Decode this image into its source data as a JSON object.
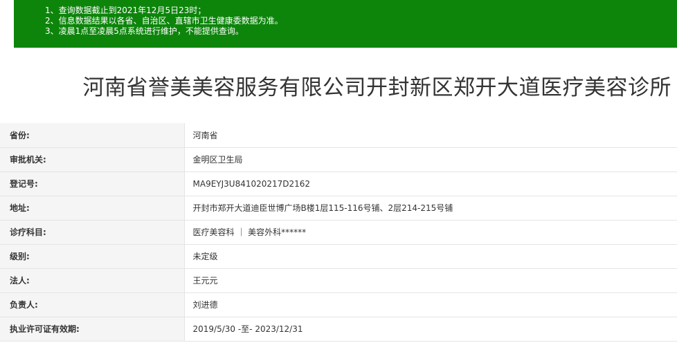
{
  "notice": {
    "lines": [
      "1、查询数据截止到2021年12月5日23时；",
      "2、信息数据结果以各省、自治区、直辖市卫生健康委数据为准。",
      "3、凌晨1点至凌晨5点系统进行维护，不能提供查询。"
    ]
  },
  "title": "河南省誉美美容服务有限公司开封新区郑开大道医疗美容诊所",
  "rows": [
    {
      "label": "省份:",
      "value": "河南省"
    },
    {
      "label": "审批机关:",
      "value": "金明区卫生局"
    },
    {
      "label": "登记号:",
      "value": "MA9EYJ3U841020217D2162"
    },
    {
      "label": "地址:",
      "value": "开封市郑开大道迪臣世博广场B楼1层115-116号铺、2层214-215号铺"
    },
    {
      "label": "诊疗科目:",
      "value": "医疗美容科 ｜ 美容外科******"
    },
    {
      "label": "级别:",
      "value": "未定级"
    },
    {
      "label": "法人:",
      "value": "王元元"
    },
    {
      "label": "负责人:",
      "value": "刘进德"
    },
    {
      "label": "执业许可证有效期:",
      "value": "2019/5/30 -至- 2023/12/31"
    }
  ],
  "colors": {
    "notice_bg": "#0d850b",
    "label_bg": "#f5f5f5",
    "border": "#e4e4e4"
  }
}
